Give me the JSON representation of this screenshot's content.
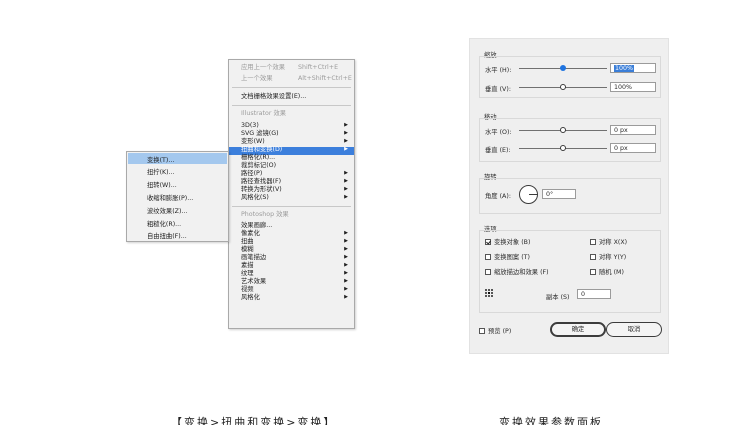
{
  "effect_menu": {
    "items_top": [
      {
        "label": "应用上一个效果",
        "shortcut": "Shift+Ctrl+E",
        "disabled": true
      },
      {
        "label": "上一个效果",
        "shortcut": "Alt+Shift+Ctrl+E",
        "disabled": true
      },
      {
        "label": "文档栅格效果设置(E)...",
        "disabled": false
      }
    ],
    "illustrator_header": "Illustrator 效果",
    "illustrator_items": [
      {
        "label": "3D(3)",
        "submenu": true
      },
      {
        "label": "SVG 滤镜(G)",
        "submenu": true
      },
      {
        "label": "变形(W)",
        "submenu": true
      },
      {
        "label": "扭曲和变换(D)",
        "submenu": true,
        "highlighted": true
      },
      {
        "label": "栅格化(R)...",
        "submenu": false
      },
      {
        "label": "裁剪标记(O)",
        "submenu": false
      },
      {
        "label": "路径(P)",
        "submenu": true
      },
      {
        "label": "路径查找器(F)",
        "submenu": true
      },
      {
        "label": "转换为形状(V)",
        "submenu": true
      },
      {
        "label": "风格化(S)",
        "submenu": true
      }
    ],
    "photoshop_header": "Photoshop 效果",
    "photoshop_items": [
      {
        "label": "效果画廊...",
        "submenu": false
      },
      {
        "label": "像素化",
        "submenu": true
      },
      {
        "label": "扭曲",
        "submenu": true
      },
      {
        "label": "模糊",
        "submenu": true
      },
      {
        "label": "画笔描边",
        "submenu": true
      },
      {
        "label": "素描",
        "submenu": true
      },
      {
        "label": "纹理",
        "submenu": true
      },
      {
        "label": "艺术效果",
        "submenu": true
      },
      {
        "label": "视频",
        "submenu": true
      },
      {
        "label": "风格化",
        "submenu": true
      }
    ]
  },
  "distort_submenu": {
    "items": [
      {
        "label": "变换(T)...",
        "highlighted": true
      },
      {
        "label": "扭拧(K)..."
      },
      {
        "label": "扭转(W)..."
      },
      {
        "label": "收缩和膨胀(P)..."
      },
      {
        "label": "波纹效果(Z)..."
      },
      {
        "label": "粗糙化(R)..."
      },
      {
        "label": "自由扭曲(F)..."
      }
    ]
  },
  "transform_dialog": {
    "scale": {
      "title": "缩放",
      "horizontal_label": "水平 (H):",
      "horizontal_value": "100%",
      "horizontal_level": 0.5,
      "vertical_label": "垂直 (V):",
      "vertical_value": "100%",
      "vertical_level": 0.5
    },
    "move": {
      "title": "移动",
      "horizontal_label": "水平 (O):",
      "horizontal_value": "0 px",
      "horizontal_level": 0.5,
      "vertical_label": "垂直 (E):",
      "vertical_value": "0 px",
      "vertical_level": 0.5
    },
    "rotate": {
      "title": "旋转",
      "angle_label": "角度 (A):",
      "angle_value": "0°"
    },
    "options": {
      "title": "选项",
      "checkboxes": [
        {
          "label": "变换对象 (B)",
          "checked": true
        },
        {
          "label": "对称 X(X)",
          "checked": false
        },
        {
          "label": "变换图案 (T)",
          "checked": false
        },
        {
          "label": "对称 Y(Y)",
          "checked": false
        },
        {
          "label": "缩放描边和效果 (F)",
          "checked": false
        },
        {
          "label": "随机 (M)",
          "checked": false
        }
      ],
      "copies_label": "副本 (S)",
      "copies_value": "0"
    },
    "preview_label": "预览 (P)",
    "preview_checked": false,
    "ok_label": "确定",
    "cancel_label": "取消"
  },
  "captions": {
    "left": "【变换>扭曲和变换>变换】",
    "right": "变换效果参数面板"
  },
  "colors": {
    "menu_highlight": "#3c7fdc",
    "submenu_highlight": "#a4c8ee",
    "slider_thumb": "#1f74e0"
  }
}
